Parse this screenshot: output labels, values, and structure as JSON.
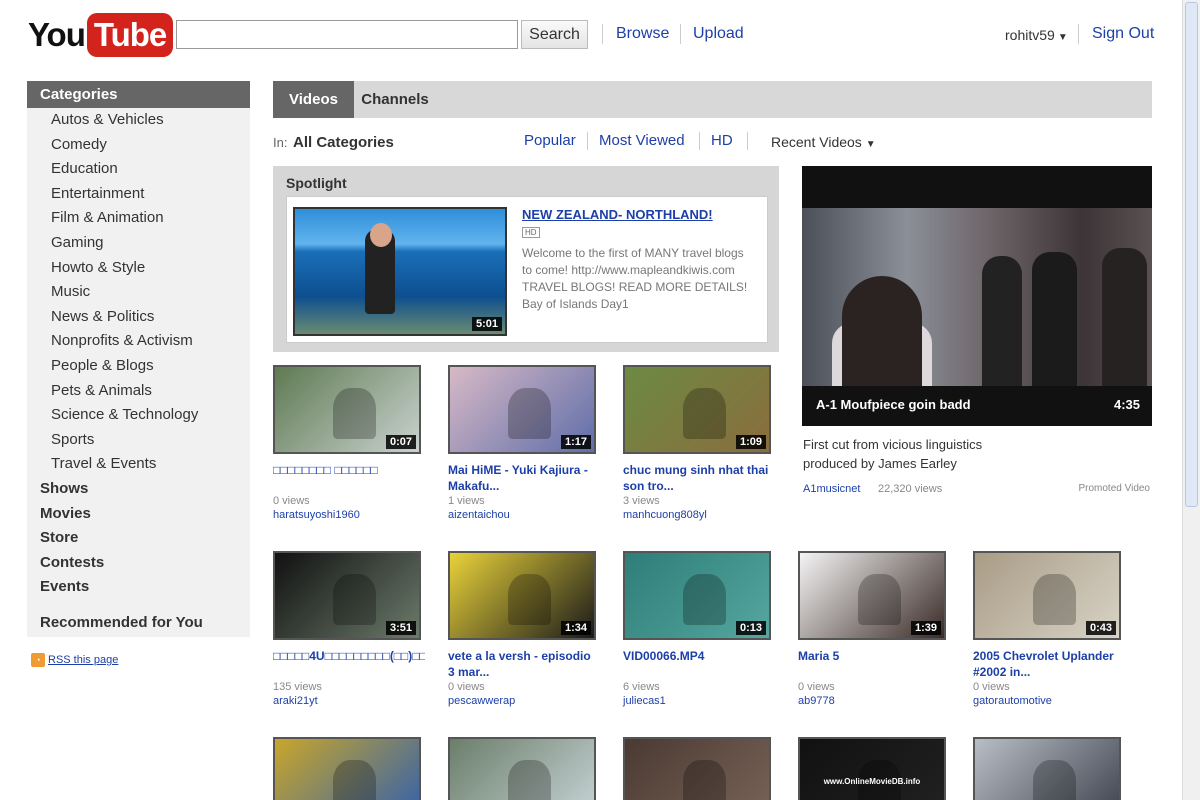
{
  "header": {
    "logo_you": "You",
    "logo_tube": "Tube",
    "search_value": "",
    "search_button": "Search",
    "browse": "Browse",
    "upload": "Upload",
    "username": "rohitv59",
    "sign_out": "Sign Out"
  },
  "sidebar": {
    "header": "Categories",
    "categories": [
      "Autos & Vehicles",
      "Comedy",
      "Education",
      "Entertainment",
      "Film & Animation",
      "Gaming",
      "Howto & Style",
      "Music",
      "News & Politics",
      "Nonprofits & Activism",
      "People & Blogs",
      "Pets & Animals",
      "Science & Technology",
      "Sports",
      "Travel & Events"
    ],
    "sections": [
      "Shows",
      "Movies",
      "Store",
      "Contests",
      "Events"
    ],
    "recommended": "Recommended for You",
    "rss": "RSS this page"
  },
  "tabs": {
    "videos": "Videos",
    "channels": "Channels"
  },
  "filters": {
    "in_label": "In:",
    "in_value": "All Categories",
    "popular": "Popular",
    "most_viewed": "Most Viewed",
    "hd": "HD",
    "recent": "Recent Videos"
  },
  "spotlight": {
    "title": "Spotlight",
    "video_title": "NEW ZEALAND- NORTHLAND!",
    "hd_badge": "HD",
    "duration": "5:01",
    "description": "Welcome to the first of MANY travel blogs to come! http://www.mapleandkiwis.com TRAVEL BLOGS! READ MORE DETAILS! Bay of Islands Day1"
  },
  "promoted": {
    "caption": "A-1 Moufpiece goin badd",
    "duration": "4:35",
    "description": "First cut from vicious linguistics produced by James Earley",
    "user": "A1musicnet",
    "views": "22,320 views",
    "label": "Promoted Video"
  },
  "videos": [
    {
      "title": "□□□□□□□□ □□□□□□",
      "duration": "0:07",
      "views": "0 views",
      "user": "haratsuyoshi1960",
      "colors": [
        "#5f7a52",
        "#c9d2cf"
      ]
    },
    {
      "title": "Mai HiME - Yuki Kajiura - Makafu...",
      "duration": "1:17",
      "views": "1 views",
      "user": "aizentaichou",
      "colors": [
        "#d7b9c6",
        "#5f6ea9"
      ]
    },
    {
      "title": "chuc mung sinh nhat thai son tro...",
      "duration": "1:09",
      "views": "3 views",
      "user": "manhcuong808yl",
      "colors": [
        "#6c8a43",
        "#8a6d3d"
      ]
    },
    {
      "title": "□□□□□4U□□□□□□□□□(□□)□□□□□□...",
      "duration": "3:51",
      "views": "135 views",
      "user": "araki21yt",
      "colors": [
        "#111111",
        "#6b7a6a"
      ]
    },
    {
      "title": "vete a la versh - episodio 3 mar...",
      "duration": "1:34",
      "views": "0 views",
      "user": "pescawwerap",
      "colors": [
        "#e9d23a",
        "#1a1a1a"
      ]
    },
    {
      "title": "VID00066.MP4",
      "duration": "0:13",
      "views": "6 views",
      "user": "juliecas1",
      "colors": [
        "#2f7d78",
        "#55a7a0"
      ]
    },
    {
      "title": "Maria 5",
      "duration": "1:39",
      "views": "0 views",
      "user": "ab9778",
      "colors": [
        "#f4f4f4",
        "#3a2b27"
      ]
    },
    {
      "title": "2005 Chevrolet Uplander #2002 in...",
      "duration": "0:43",
      "views": "0 views",
      "user": "gatorautomotive",
      "colors": [
        "#a99c86",
        "#d8d3c6"
      ]
    },
    {
      "title": "",
      "duration": "",
      "views": "",
      "user": "",
      "colors": [
        "#c9a62a",
        "#2f5fb0"
      ]
    },
    {
      "title": "",
      "duration": "",
      "views": "",
      "user": "",
      "colors": [
        "#6b7e6a",
        "#c9d6d9"
      ]
    },
    {
      "title": "",
      "duration": "",
      "views": "",
      "user": "",
      "colors": [
        "#4a3a33",
        "#7a6458"
      ]
    },
    {
      "title": "",
      "duration": "",
      "views": "",
      "user": "",
      "colors": [
        "#111111",
        "#222222"
      ],
      "overlay": "www.OnlineMovieDB.info"
    },
    {
      "title": "",
      "duration": "",
      "views": "",
      "user": "",
      "colors": [
        "#b9bec6",
        "#3a3f4a"
      ]
    }
  ],
  "colors": {
    "link": "#1c3fa8",
    "logo_red": "#d3231d",
    "tab_active": "#666666"
  }
}
